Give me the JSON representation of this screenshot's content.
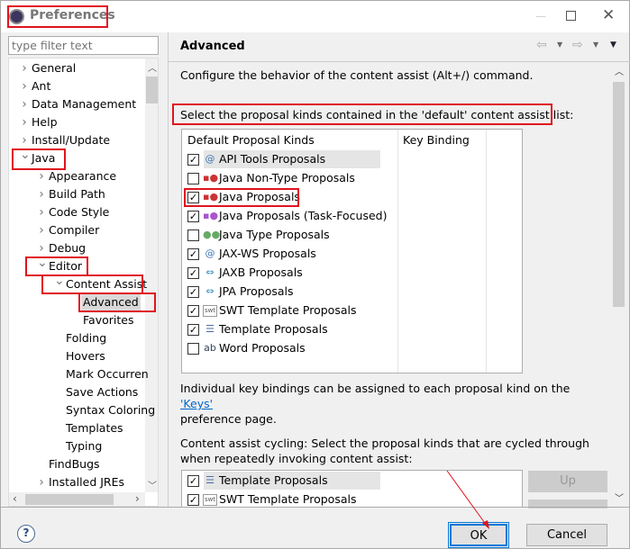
{
  "window": {
    "title": "Preferences"
  },
  "filter": {
    "placeholder": "type filter text"
  },
  "tree": [
    {
      "label": "General",
      "level": 0,
      "chevron": "right"
    },
    {
      "label": "Ant",
      "level": 0,
      "chevron": "right"
    },
    {
      "label": "Data Management",
      "level": 0,
      "chevron": "right"
    },
    {
      "label": "Help",
      "level": 0,
      "chevron": "right"
    },
    {
      "label": "Install/Update",
      "level": 0,
      "chevron": "right"
    },
    {
      "label": "Java",
      "level": 0,
      "chevron": "down"
    },
    {
      "label": "Appearance",
      "level": 1,
      "chevron": "right"
    },
    {
      "label": "Build Path",
      "level": 1,
      "chevron": "right"
    },
    {
      "label": "Code Style",
      "level": 1,
      "chevron": "right"
    },
    {
      "label": "Compiler",
      "level": 1,
      "chevron": "right"
    },
    {
      "label": "Debug",
      "level": 1,
      "chevron": "right"
    },
    {
      "label": "Editor",
      "level": 1,
      "chevron": "down"
    },
    {
      "label": "Content Assist",
      "level": 2,
      "chevron": "down"
    },
    {
      "label": "Advanced",
      "level": 3,
      "chevron": "",
      "selected": true
    },
    {
      "label": "Favorites",
      "level": 3,
      "chevron": ""
    },
    {
      "label": "Folding",
      "level": 2,
      "chevron": ""
    },
    {
      "label": "Hovers",
      "level": 2,
      "chevron": ""
    },
    {
      "label": "Mark Occurren",
      "level": 2,
      "chevron": ""
    },
    {
      "label": "Save Actions",
      "level": 2,
      "chevron": ""
    },
    {
      "label": "Syntax Coloring",
      "level": 2,
      "chevron": ""
    },
    {
      "label": "Templates",
      "level": 2,
      "chevron": ""
    },
    {
      "label": "Typing",
      "level": 2,
      "chevron": ""
    },
    {
      "label": "FindBugs",
      "level": 1,
      "chevron": ""
    },
    {
      "label": "Installed JREs",
      "level": 1,
      "chevron": "right"
    }
  ],
  "page": {
    "title": "Advanced",
    "description": "Configure the behavior of the content assist (Alt+/) command.",
    "select_label": "Select the proposal kinds contained in the 'default' content assist list:",
    "col_kinds": "Default Proposal Kinds",
    "col_binding": "Key Binding",
    "proposals": [
      {
        "label": "API Tools Proposals",
        "checked": true,
        "icon": "at-icon",
        "selected": true
      },
      {
        "label": "Java Non-Type Proposals",
        "checked": false,
        "icon": "shapes-icon"
      },
      {
        "label": "Java Proposals",
        "checked": true,
        "icon": "shapes-icon"
      },
      {
        "label": "Java Proposals (Task-Focused)",
        "checked": true,
        "icon": "shapes-task-icon"
      },
      {
        "label": "Java Type Proposals",
        "checked": false,
        "icon": "type-icon"
      },
      {
        "label": "JAX-WS Proposals",
        "checked": true,
        "icon": "at-icon"
      },
      {
        "label": "JAXB Proposals",
        "checked": true,
        "icon": "arrows-icon"
      },
      {
        "label": "JPA Proposals",
        "checked": true,
        "icon": "arrows-icon"
      },
      {
        "label": "SWT Template Proposals",
        "checked": true,
        "icon": "swt-icon"
      },
      {
        "label": "Template Proposals",
        "checked": true,
        "icon": "template-icon"
      },
      {
        "label": "Word Proposals",
        "checked": false,
        "icon": "word-icon"
      }
    ],
    "keys_text_before": "Individual key bindings can be assigned to each proposal kind on the ",
    "keys_link": "'Keys'",
    "keys_text_after": "preference page.",
    "cycling_label": "Content assist cycling: Select the proposal kinds that are cycled through when repeatedly invoking content assist:",
    "cycling": [
      {
        "label": "Template Proposals",
        "checked": true,
        "icon": "template-icon",
        "selected": true
      },
      {
        "label": "SWT Template Proposals",
        "checked": true,
        "icon": "swt-icon"
      }
    ],
    "up_label": "Up"
  },
  "buttons": {
    "ok": "OK",
    "cancel": "Cancel",
    "help": "?"
  },
  "colors": {
    "highlight": "#e0141e",
    "ok_border": "#0078d7",
    "link": "#0066cc"
  }
}
